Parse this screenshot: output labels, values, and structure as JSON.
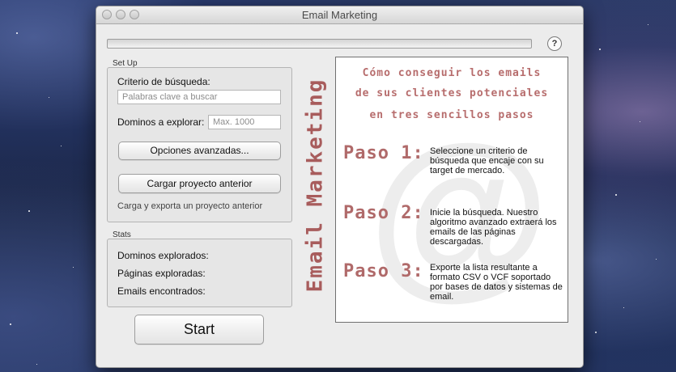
{
  "window": {
    "title": "Email Marketing"
  },
  "help": {
    "label": "?"
  },
  "progress": {
    "value": 0
  },
  "setup": {
    "group_title": "Set Up",
    "criteria_label": "Criterio de búsqueda:",
    "criteria_placeholder": "Palabras clave a buscar",
    "domains_label": "Dominos a explorar:",
    "domains_placeholder": "Max. 1000",
    "advanced_button": "Opciones avanzadas...",
    "load_button": "Cargar proyecto anterior",
    "load_note": "Carga y exporta un proyecto anterior"
  },
  "stats": {
    "group_title": "Stats",
    "domains": "Dominos explorados:",
    "pages": "Páginas exploradas:",
    "emails": "Emails encontrados:"
  },
  "start_button": "Start",
  "vertical_title": "Email Marketing",
  "info": {
    "watermark": "@",
    "title_lines": [
      "Cómo conseguir los emails",
      "de sus clientes potenciales",
      "en tres sencillos pasos"
    ],
    "steps": [
      {
        "label": "Paso 1:",
        "text": "Seleccione un criterio de búsqueda que encaje con su target de mercado."
      },
      {
        "label": "Paso 2:",
        "text": "Inicie la búsqueda. Nuestro algoritmo avanzado extraerá los emails de las páginas descargadas."
      },
      {
        "label": "Paso 3:",
        "text": "Exporte la lista resultante a formato CSV o VCF soportado por bases de datos y sistemas de email."
      }
    ]
  }
}
